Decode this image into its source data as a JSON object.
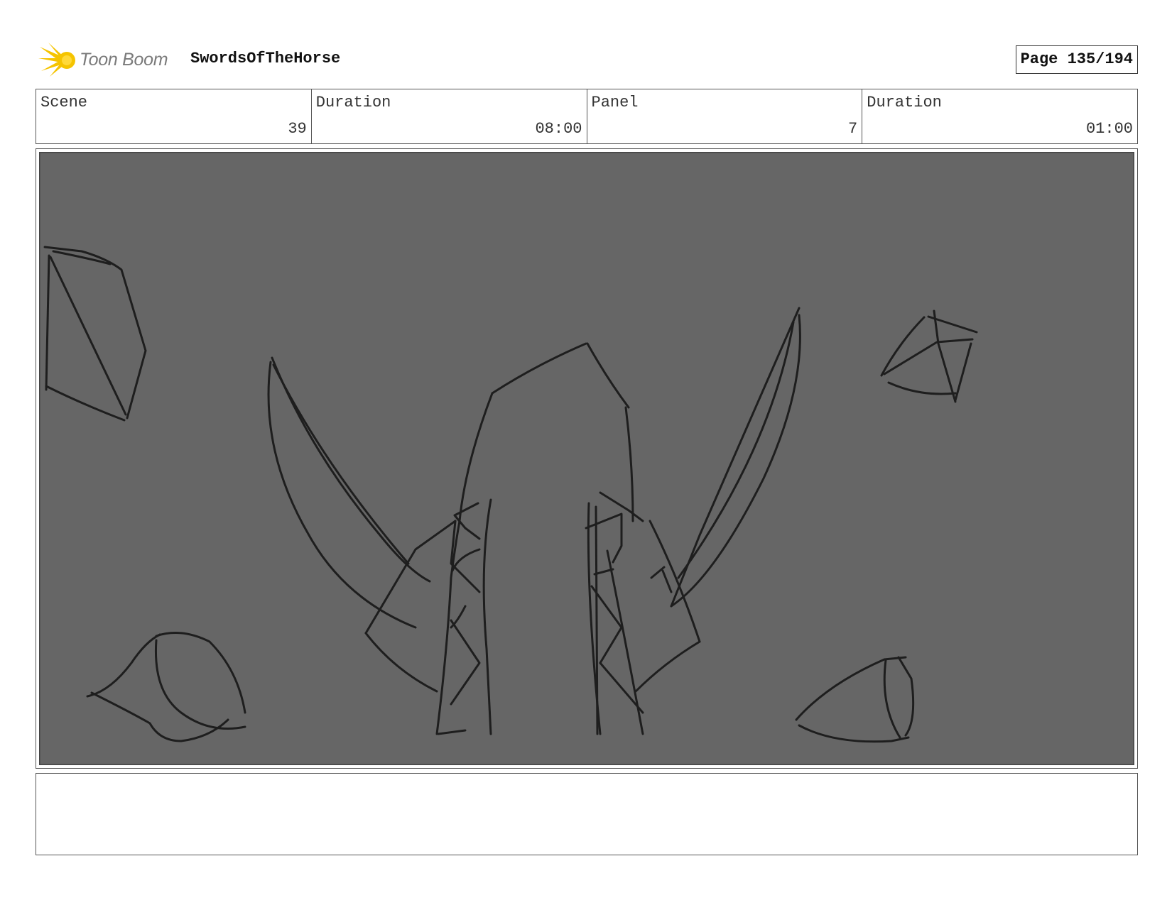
{
  "header": {
    "logo_text": "Toon Boom",
    "project_title": "SwordsOfTheHorse",
    "page_label": "Page 135/194"
  },
  "info": {
    "scene_label": "Scene",
    "scene_value": "39",
    "scene_duration_label": "Duration",
    "scene_duration_value": "08:00",
    "panel_label": "Panel",
    "panel_value": "7",
    "panel_duration_label": "Duration",
    "panel_duration_value": "01:00"
  },
  "panel": {
    "background_color": "#666666",
    "stroke_color": "#1e1e1e"
  },
  "notes": {
    "text": ""
  },
  "colors": {
    "logo_star": "#f5c400",
    "logo_text": "#7a7a7a"
  }
}
